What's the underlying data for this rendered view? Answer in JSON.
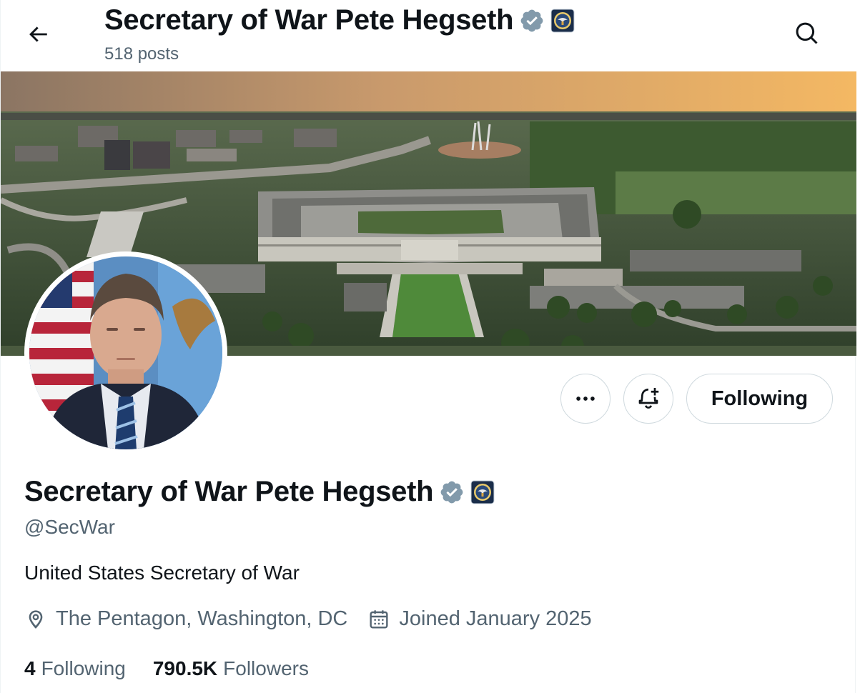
{
  "header": {
    "title": "Secretary of War Pete Hegseth",
    "posts_count": "518 posts"
  },
  "icons": {
    "back": "arrow-left-icon",
    "search": "search-icon",
    "verified": "verified-badge-icon",
    "affiliation": "department-seal-icon",
    "more": "more-dots-icon",
    "notify": "bell-plus-icon",
    "location": "location-pin-icon",
    "calendar": "calendar-icon"
  },
  "actions": {
    "following_label": "Following"
  },
  "profile": {
    "name": "Secretary of War Pete Hegseth",
    "handle": "@SecWar",
    "bio": "United States Secretary of War",
    "location": "The Pentagon, Washington, DC",
    "joined": "Joined January 2025",
    "following_count": "4",
    "following_label": "Following",
    "followers_count": "790.5K",
    "followers_label": "Followers"
  },
  "colors": {
    "text": "#0f1419",
    "secondary": "#536471",
    "border": "#cfd9de",
    "verified": "#829aab"
  }
}
